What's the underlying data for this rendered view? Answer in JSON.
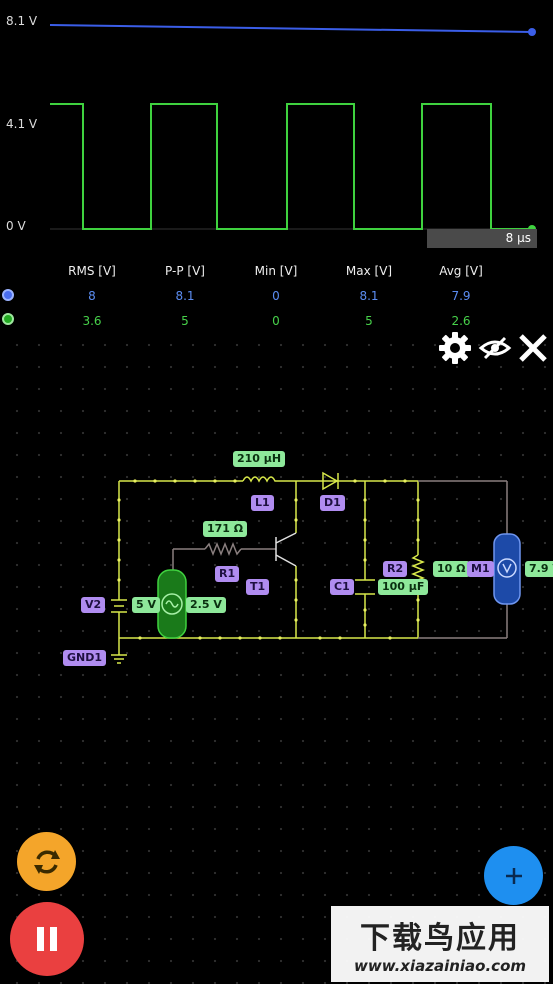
{
  "scope": {
    "y_labels": [
      "8.1 V",
      "4.1 V",
      "0 V"
    ],
    "time_label": "8 µs",
    "trace_colors": {
      "blue": "#3b5ee8",
      "green": "#3fd23f"
    },
    "stats_headers": [
      "RMS [V]",
      "P-P [V]",
      "Min [V]",
      "Max [V]",
      "Avg [V]"
    ],
    "rows": [
      {
        "values": [
          "8",
          "8.1",
          "0",
          "8.1",
          "7.9"
        ]
      },
      {
        "values": [
          "3.6",
          "5",
          "0",
          "5",
          "2.6"
        ]
      }
    ]
  },
  "toolbar": {
    "settings_icon": "gear-icon",
    "visibility_icon": "eye-off-icon",
    "close_icon": "close-icon"
  },
  "circuit": {
    "inductor_value": "210 µH",
    "inductor_name": "L1",
    "diode_name": "D1",
    "resistor1_value": "171 Ω",
    "resistor1_name": "R1",
    "transistor_name": "T1",
    "capacitor_name": "C1",
    "capacitor_value": "100 µF",
    "resistor2_name": "R2",
    "resistor2_value": "10 Ω",
    "meter_name": "M1",
    "meter_value": "7.9 V",
    "source_name": "V2",
    "source_amplitude": "5 V",
    "source_offset": "2.5 V",
    "ground_name": "GND1"
  },
  "controls": {
    "refresh_color": "#f4a52a",
    "pause_color": "#ea4040",
    "add_color": "#1e8ff0"
  },
  "watermark": {
    "cn": "下载鸟应用",
    "url": "www.xiazainiao.com"
  }
}
